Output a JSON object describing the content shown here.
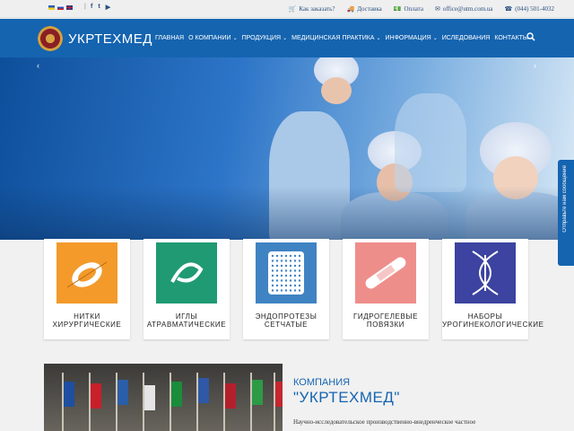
{
  "topbar": {
    "social": [
      "f",
      "t",
      "▶"
    ],
    "links": [
      {
        "icon": "cart-icon",
        "glyph": "🛒",
        "label": "Как заказать?"
      },
      {
        "icon": "truck-icon",
        "glyph": "🚚",
        "label": "Доставка"
      },
      {
        "icon": "money-icon",
        "glyph": "💵",
        "label": "Оплата"
      },
      {
        "icon": "mail-icon",
        "glyph": "✉",
        "label": "office@utm.com.ua"
      },
      {
        "icon": "phone-icon",
        "glyph": "☎",
        "label": "(044) 501-4032"
      }
    ]
  },
  "nav": {
    "brand": "УКРТЕХМЕД",
    "items": [
      {
        "label": "ГЛАВНАЯ",
        "dropdown": false
      },
      {
        "label": "О КОМПАНИИ",
        "dropdown": true
      },
      {
        "label": "ПРОДУКЦИЯ",
        "dropdown": true
      },
      {
        "label": "МЕДИЦИНСКАЯ ПРАКТИКА",
        "dropdown": true
      },
      {
        "label": "ИНФОРМАЦИЯ",
        "dropdown": true
      },
      {
        "label": "ИСЛЕДОВАНИЯ",
        "dropdown": false
      },
      {
        "label": "КОНТАКТЫ",
        "dropdown": false
      }
    ]
  },
  "slider": {
    "prev": "‹",
    "next": "›"
  },
  "sidetab": {
    "label": "Отправьте нам сообщение"
  },
  "products": [
    {
      "line1": "НИТКИ",
      "line2": "ХИРУРГИЧЕСКИЕ",
      "color": "#f39a2b"
    },
    {
      "line1": "ИГЛЫ",
      "line2": "АТРАВМАТИЧЕСКИЕ",
      "color": "#1f9a73"
    },
    {
      "line1": "ЭНДОПРОТЕЗЫ",
      "line2": "СЕТЧАТЫЕ",
      "color": "#3f83c3"
    },
    {
      "line1": "ГИДРОГЕЛЕВЫЕ",
      "line2": "ПОВЯЗКИ",
      "color": "#ee8e8b"
    },
    {
      "line1": "НАБОРЫ",
      "line2": "УРОГИНЕКОЛОГИЧЕСКИЕ",
      "color": "#3c43a0"
    }
  ],
  "company": {
    "subtitle": "КОМПАНИЯ",
    "title": "\"УКРТЕХМЕД\"",
    "text": "Научно-исследовательское производственно-внедренческое частное"
  }
}
